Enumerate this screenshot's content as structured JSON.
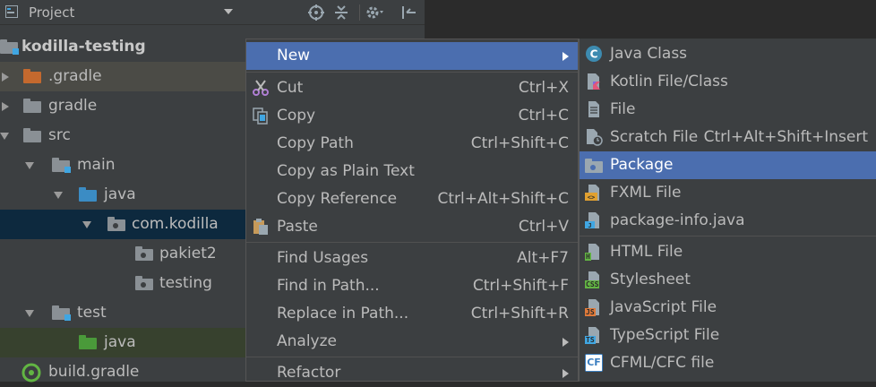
{
  "toolbar": {
    "title": "Project",
    "icons": [
      "project-view-icon",
      "dropdown-arrow-icon",
      "scroll-from-source-icon",
      "collapse-all-icon",
      "settings-gear-icon",
      "hide-panel-icon"
    ]
  },
  "tree": [
    {
      "label": "kodilla-testing",
      "bold": true,
      "icon": "module-folder-icon"
    },
    {
      "label": ".gradle",
      "icon": "folder-icon",
      "folder_color": "#c4692e"
    },
    {
      "label": "gradle",
      "icon": "folder-icon"
    },
    {
      "label": "src",
      "icon": "folder-icon"
    },
    {
      "label": "main",
      "icon": "source-root-folder-icon"
    },
    {
      "label": "java",
      "icon": "source-folder-icon",
      "folder_color": "#3b8cc4"
    },
    {
      "label": "com.kodilla",
      "icon": "package-icon"
    },
    {
      "label": "pakiet2",
      "icon": "package-icon"
    },
    {
      "label": "testing",
      "icon": "package-icon"
    },
    {
      "label": "test",
      "icon": "test-root-folder-icon"
    },
    {
      "label": "java",
      "icon": "test-source-folder-icon",
      "folder_color": "#4a9a3a"
    },
    {
      "label": "build.gradle",
      "icon": "gradle-icon"
    }
  ],
  "context_menu": {
    "items": [
      {
        "label": "New",
        "shortcut": "",
        "submenu": true,
        "highlighted": true
      },
      {
        "label": "Cut",
        "shortcut": "Ctrl+X",
        "icon": "scissors-icon"
      },
      {
        "label": "Copy",
        "shortcut": "Ctrl+C",
        "icon": "copy-icon"
      },
      {
        "label": "Copy Path",
        "shortcut": "Ctrl+Shift+C"
      },
      {
        "label": "Copy as Plain Text",
        "shortcut": ""
      },
      {
        "label": "Copy Reference",
        "shortcut": "Ctrl+Alt+Shift+C"
      },
      {
        "label": "Paste",
        "shortcut": "Ctrl+V",
        "icon": "paste-icon"
      },
      {
        "label": "Find Usages",
        "shortcut": "Alt+F7"
      },
      {
        "label": "Find in Path...",
        "shortcut": "Ctrl+Shift+F"
      },
      {
        "label": "Replace in Path...",
        "shortcut": "Ctrl+Shift+R"
      },
      {
        "label": "Analyze",
        "shortcut": "",
        "submenu": true
      },
      {
        "label": "Refactor",
        "shortcut": "",
        "submenu": true
      }
    ]
  },
  "new_submenu": {
    "items": [
      {
        "label": "Java Class",
        "shortcut": "",
        "icon": "java-class-icon"
      },
      {
        "label": "Kotlin File/Class",
        "shortcut": "",
        "icon": "kotlin-file-icon"
      },
      {
        "label": "File",
        "shortcut": "",
        "icon": "file-icon"
      },
      {
        "label": "Scratch File",
        "shortcut": "Ctrl+Alt+Shift+Insert",
        "icon": "scratch-file-icon"
      },
      {
        "label": "Package",
        "shortcut": "",
        "icon": "package-icon",
        "highlighted": true
      },
      {
        "label": "FXML File",
        "shortcut": "",
        "icon": "fxml-file-icon"
      },
      {
        "label": "package-info.java",
        "shortcut": "",
        "icon": "java-file-icon"
      },
      {
        "label": "HTML File",
        "shortcut": "",
        "icon": "html-file-icon",
        "badge": "H"
      },
      {
        "label": "Stylesheet",
        "shortcut": "",
        "icon": "css-file-icon",
        "badge": "CSS"
      },
      {
        "label": "JavaScript File",
        "shortcut": "",
        "icon": "javascript-file-icon",
        "badge": "JS"
      },
      {
        "label": "TypeScript File",
        "shortcut": "",
        "icon": "typescript-file-icon",
        "badge": "TS"
      },
      {
        "label": "CFML/CFC file",
        "shortcut": "",
        "icon": "cfml-file-icon",
        "badge": "CF"
      }
    ]
  },
  "colors": {
    "panel_bg": "#3c3f41",
    "highlight": "#4b6eaf",
    "folder_default": "#8a9095",
    "package_folder": "#8a9095"
  }
}
